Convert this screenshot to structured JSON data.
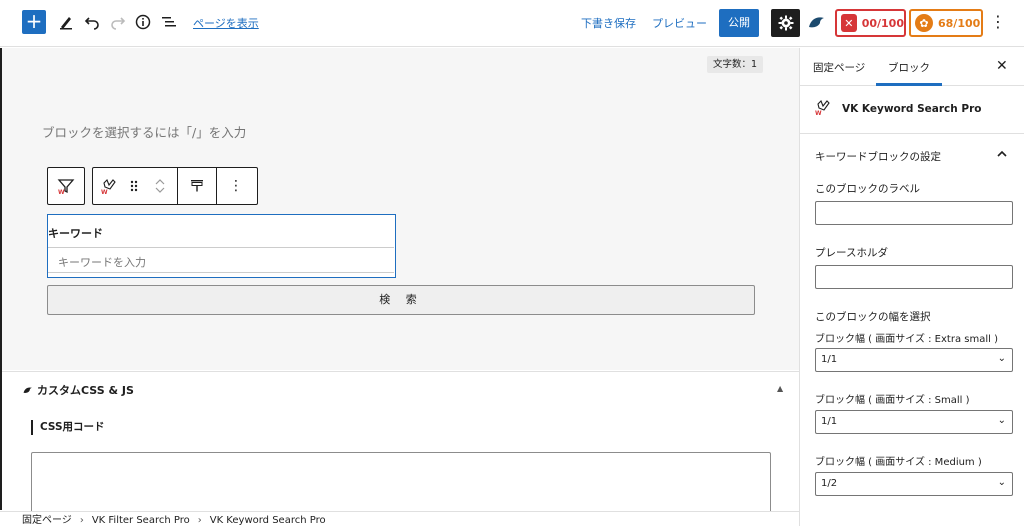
{
  "toolbar": {
    "view_page": "ページを表示",
    "save_draft": "下書き保存",
    "preview": "プレビュー",
    "publish": "公開",
    "score1": "00/100",
    "score2": "68/100",
    "colors": {
      "accent": "#1e6ec0",
      "score1": "#d63638",
      "score2": "#e47c16"
    }
  },
  "editor": {
    "word_count": "文字数：1",
    "placeholder": "ブロックを選択するには「/」を入力",
    "keyword_label": "キーワード",
    "keyword_placeholder": "キーワードを入力",
    "search_button": "検 索"
  },
  "meta": {
    "title": "カスタムCSS & JS",
    "css_label": "CSS用コード"
  },
  "breadcrumb": [
    "固定ページ",
    "VK Filter Search Pro",
    "VK Keyword Search Pro"
  ],
  "sidebar": {
    "tab_page": "固定ページ",
    "tab_block": "ブロック",
    "block_name": "VK Keyword Search Pro",
    "section_title": "キーワードブロックの設定",
    "label_field": "このブロックのラベル",
    "placeholder_field": "プレースホルダ",
    "width_title": "このブロックの幅を選択",
    "width_xs_label": "ブロック幅 ( 画面サイズ : Extra small )",
    "width_xs_value": "1/1",
    "width_sm_label": "ブロック幅 ( 画面サイズ : Small )",
    "width_sm_value": "1/1",
    "width_md_label": "ブロック幅 ( 画面サイズ : Medium )",
    "width_md_value": "1/2"
  }
}
